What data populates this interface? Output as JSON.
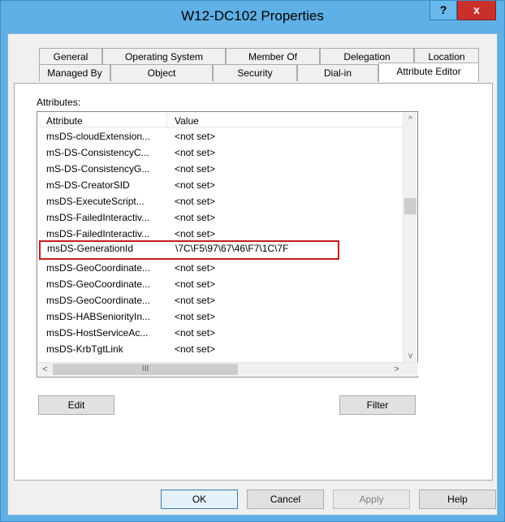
{
  "window": {
    "title": "W12-DC102 Properties",
    "help_label": "?",
    "close_label": "x"
  },
  "tabs_row1": [
    {
      "label": "General"
    },
    {
      "label": "Operating System"
    },
    {
      "label": "Member Of"
    },
    {
      "label": "Delegation"
    },
    {
      "label": "Location"
    }
  ],
  "tabs_row2": [
    {
      "label": "Managed By"
    },
    {
      "label": "Object"
    },
    {
      "label": "Security"
    },
    {
      "label": "Dial-in"
    },
    {
      "label": "Attribute Editor",
      "active": true
    }
  ],
  "attributes": {
    "label": "Attributes:",
    "columns": {
      "attribute": "Attribute",
      "value": "Value"
    },
    "rows": [
      {
        "attribute": "msDS-cloudExtension...",
        "value": "<not set>"
      },
      {
        "attribute": "mS-DS-ConsistencyC...",
        "value": "<not set>"
      },
      {
        "attribute": "mS-DS-ConsistencyG...",
        "value": "<not set>"
      },
      {
        "attribute": "mS-DS-CreatorSID",
        "value": "<not set>"
      },
      {
        "attribute": "msDS-ExecuteScript...",
        "value": "<not set>"
      },
      {
        "attribute": "msDS-FailedInteractiv...",
        "value": "<not set>"
      },
      {
        "attribute": "msDS-FailedInteractiv...",
        "value": "<not set>"
      },
      {
        "attribute": "msDS-GenerationId",
        "value": "\\7C\\F5\\97\\67\\46\\F7\\1C\\7F",
        "highlighted": true
      },
      {
        "attribute": "msDS-GeoCoordinate...",
        "value": "<not set>"
      },
      {
        "attribute": "msDS-GeoCoordinate...",
        "value": "<not set>"
      },
      {
        "attribute": "msDS-GeoCoordinate...",
        "value": "<not set>"
      },
      {
        "attribute": "msDS-HABSeniorityIn...",
        "value": "<not set>"
      },
      {
        "attribute": "msDS-HostServiceAc...",
        "value": "<not set>"
      },
      {
        "attribute": "msDS-KrbTgtLink",
        "value": "<not set>"
      }
    ],
    "hscroll_thumb": "III",
    "arrows": {
      "up": "^",
      "down": "v",
      "left": "<",
      "right": ">"
    }
  },
  "buttons": {
    "edit": "Edit",
    "filter": "Filter",
    "ok": "OK",
    "cancel": "Cancel",
    "apply": "Apply",
    "help": "Help"
  },
  "colors": {
    "title_bar": "#5fb0e6",
    "close_button": "#c9302c",
    "highlight_border": "#c41e1e"
  }
}
